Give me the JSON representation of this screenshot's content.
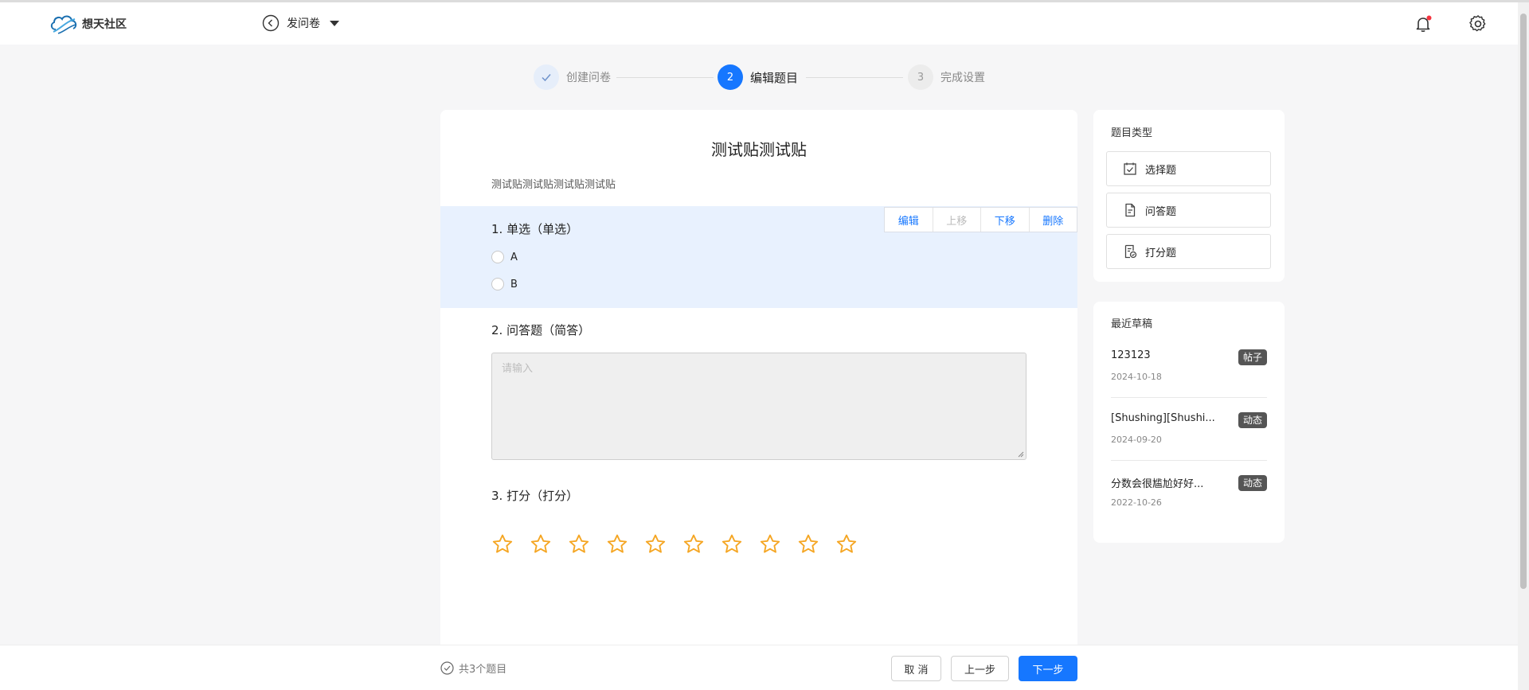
{
  "header": {
    "logo_text": "想天社区",
    "back_label": "发问卷"
  },
  "steps": [
    {
      "index": "✓",
      "label": "创建问卷",
      "state": "done"
    },
    {
      "index": "2",
      "label": "编辑题目",
      "state": "active"
    },
    {
      "index": "3",
      "label": "完成设置",
      "state": "todo"
    }
  ],
  "survey": {
    "title": "测试贴测试贴",
    "description": "测试贴测试贴测试贴测试贴",
    "actions": {
      "edit": "编辑",
      "up": "上移",
      "down": "下移",
      "delete": "删除"
    },
    "q1": {
      "title": "1. 单选（单选）",
      "options": [
        "A",
        "B"
      ]
    },
    "q2": {
      "title": "2. 问答题（简答）",
      "placeholder": "请输入"
    },
    "q3": {
      "title": "3. 打分（打分）",
      "stars_total": 10,
      "stars_filled": 0
    }
  },
  "question_types": {
    "title": "题目类型",
    "items": [
      {
        "label": "选择题",
        "icon": "checkbox-calendar-icon"
      },
      {
        "label": "问答题",
        "icon": "document-icon"
      },
      {
        "label": "打分题",
        "icon": "rating-doc-icon"
      }
    ]
  },
  "drafts": {
    "title": "最近草稿",
    "items": [
      {
        "name": "123123",
        "badge": "帖子",
        "date": "2024-10-18"
      },
      {
        "name": "[Shushing][Shushi...",
        "badge": "动态",
        "date": "2024-09-20"
      },
      {
        "name": "分数会很尴尬好好...",
        "badge": "动态",
        "date": "2022-10-26"
      }
    ]
  },
  "footer": {
    "count_label": "共3个题目",
    "cancel": "取 消",
    "prev": "上一步",
    "next": "下一步"
  },
  "colors": {
    "accent": "#1677ff",
    "star": "#f5a623",
    "selected_bg": "#e8f1fe"
  }
}
